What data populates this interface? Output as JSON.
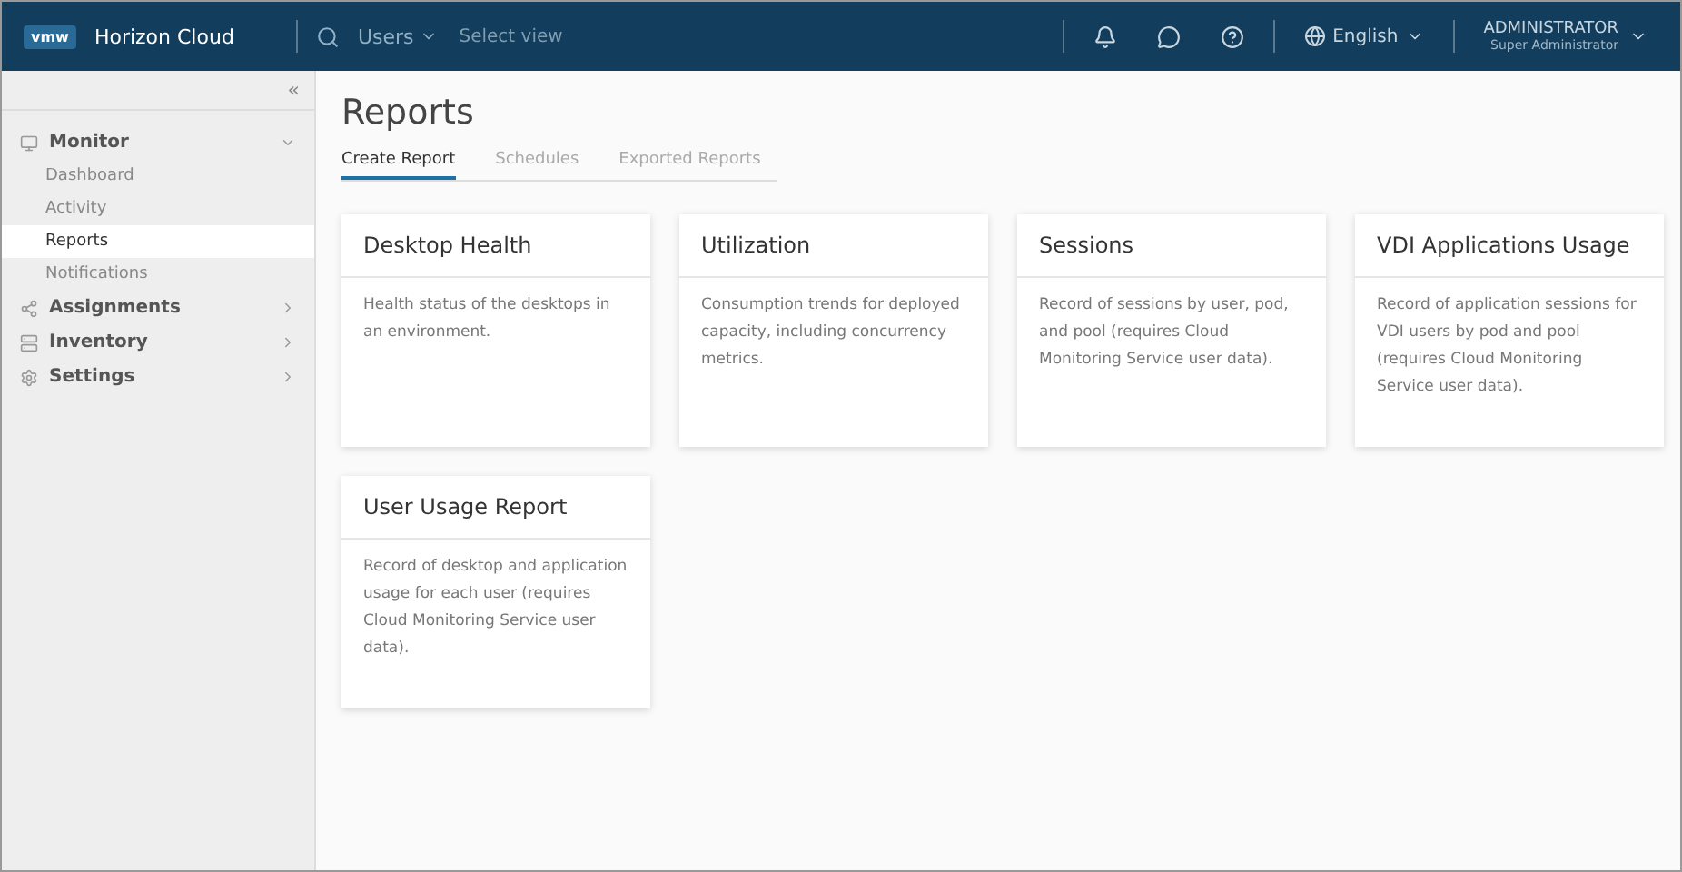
{
  "header": {
    "logo": "vmw",
    "product": "Horizon Cloud",
    "search_scope": "Users",
    "search": {
      "placeholder": "Select view"
    },
    "language": "English",
    "user": {
      "name": "ADMINISTRATOR",
      "role": "Super Administrator"
    }
  },
  "sidebar": {
    "collapse": "«",
    "items": [
      {
        "label": "Monitor",
        "expanded": true,
        "children": [
          {
            "label": "Dashboard",
            "selected": false
          },
          {
            "label": "Activity",
            "selected": false
          },
          {
            "label": "Reports",
            "selected": true
          },
          {
            "label": "Notifications",
            "selected": false
          }
        ]
      },
      {
        "label": "Assignments",
        "expanded": false
      },
      {
        "label": "Inventory",
        "expanded": false
      },
      {
        "label": "Settings",
        "expanded": false
      }
    ]
  },
  "page": {
    "title": "Reports",
    "tabs": [
      {
        "label": "Create Report",
        "selected": true
      },
      {
        "label": "Schedules",
        "selected": false
      },
      {
        "label": "Exported Reports",
        "selected": false
      }
    ],
    "cards": [
      {
        "title": "Desktop Health",
        "description": "Health status of the desktops in an environment."
      },
      {
        "title": "Utilization",
        "description": "Consumption trends for deployed capacity, including concurrency metrics."
      },
      {
        "title": "Sessions",
        "description": "Record of sessions by user, pod, and pool (requires Cloud Monitoring Service user data)."
      },
      {
        "title": "VDI Applications Usage",
        "description": "Record of application sessions for VDI users by pod and pool (requires Cloud Monitoring Service user data)."
      },
      {
        "title": "User Usage Report",
        "description": "Record of desktop and application usage for each user (requires Cloud Monitoring Service user data)."
      }
    ]
  }
}
